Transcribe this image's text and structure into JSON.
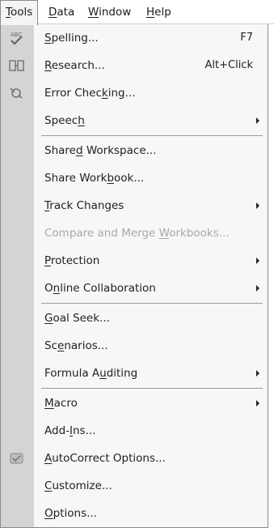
{
  "menubar": {
    "items": [
      {
        "label": "Tools",
        "key": "T"
      },
      {
        "label": "Data",
        "key": "D"
      },
      {
        "label": "Window",
        "key": "W"
      },
      {
        "label": "Help",
        "key": "H"
      }
    ]
  },
  "menu": {
    "items": [
      {
        "pre": "",
        "key": "S",
        "post": "pelling...",
        "shortcut": "F7",
        "icon": "spelling-icon"
      },
      {
        "pre": "",
        "key": "R",
        "post": "esearch...",
        "shortcut": "Alt+Click",
        "icon": "research-icon"
      },
      {
        "pre": "Error Chec",
        "key": "k",
        "post": "ing...",
        "icon": "error-checking-icon"
      },
      {
        "pre": "Speec",
        "key": "h",
        "post": "",
        "submenu": true
      },
      {
        "pre": "Share",
        "key": "d",
        "post": " Workspace..."
      },
      {
        "pre": "Share Work",
        "key": "b",
        "post": "ook..."
      },
      {
        "pre": "",
        "key": "T",
        "post": "rack Changes",
        "submenu": true
      },
      {
        "pre": "Compare and Merge ",
        "key": "W",
        "post": "orkbooks...",
        "disabled": true
      },
      {
        "pre": "",
        "key": "P",
        "post": "rotection",
        "submenu": true
      },
      {
        "pre": "O",
        "key": "n",
        "post": "line Collaboration",
        "submenu": true
      },
      {
        "pre": "",
        "key": "G",
        "post": "oal Seek..."
      },
      {
        "pre": "Sc",
        "key": "e",
        "post": "narios..."
      },
      {
        "pre": "Formula A",
        "key": "u",
        "post": "diting",
        "submenu": true
      },
      {
        "pre": "",
        "key": "M",
        "post": "acro",
        "submenu": true
      },
      {
        "pre": "Add-",
        "key": "I",
        "post": "ns..."
      },
      {
        "pre": "",
        "key": "A",
        "post": "utoCorrect Options...",
        "icon": "autocorrect-icon"
      },
      {
        "pre": "",
        "key": "C",
        "post": "ustomize..."
      },
      {
        "pre": "",
        "key": "O",
        "post": "ptions..."
      }
    ]
  },
  "colors": {
    "gutter": "#d4d4d4",
    "menu_background": "#f7f7f7",
    "disabled_text": "#a8a8a8",
    "border": "#8a8a8a"
  }
}
